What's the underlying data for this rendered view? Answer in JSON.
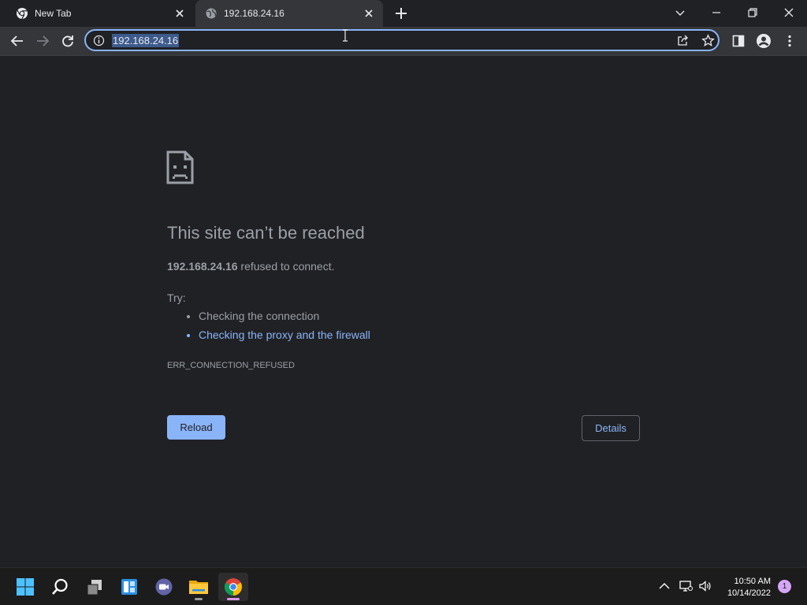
{
  "tabs": [
    {
      "title": "New Tab",
      "icon": "chrome-icon",
      "active": false
    },
    {
      "title": "192.168.24.16",
      "icon": "globe-icon",
      "active": true
    }
  ],
  "omnibox": {
    "url": "192.168.24.16"
  },
  "error_page": {
    "title": "This site can’t be reached",
    "host": "192.168.24.16",
    "message": " refused to connect.",
    "try_label": "Try:",
    "suggestions": [
      "Checking the connection",
      "Checking the proxy and the firewall"
    ],
    "error_code": "ERR_CONNECTION_REFUSED",
    "reload_label": "Reload",
    "details_label": "Details"
  },
  "taskbar": {
    "apps": [
      "start-icon",
      "search-icon",
      "task-view-icon",
      "widgets-icon",
      "teams-chat-icon",
      "file-explorer-icon",
      "chrome-icon"
    ],
    "clock_time": "10:50 AM",
    "clock_date": "10/14/2022",
    "notification_count": "1"
  },
  "colors": {
    "page_bg": "#202124",
    "toolbar_bg": "#35363a",
    "accent_blue": "#8ab4f8",
    "text_gray": "#9aa0a6"
  }
}
